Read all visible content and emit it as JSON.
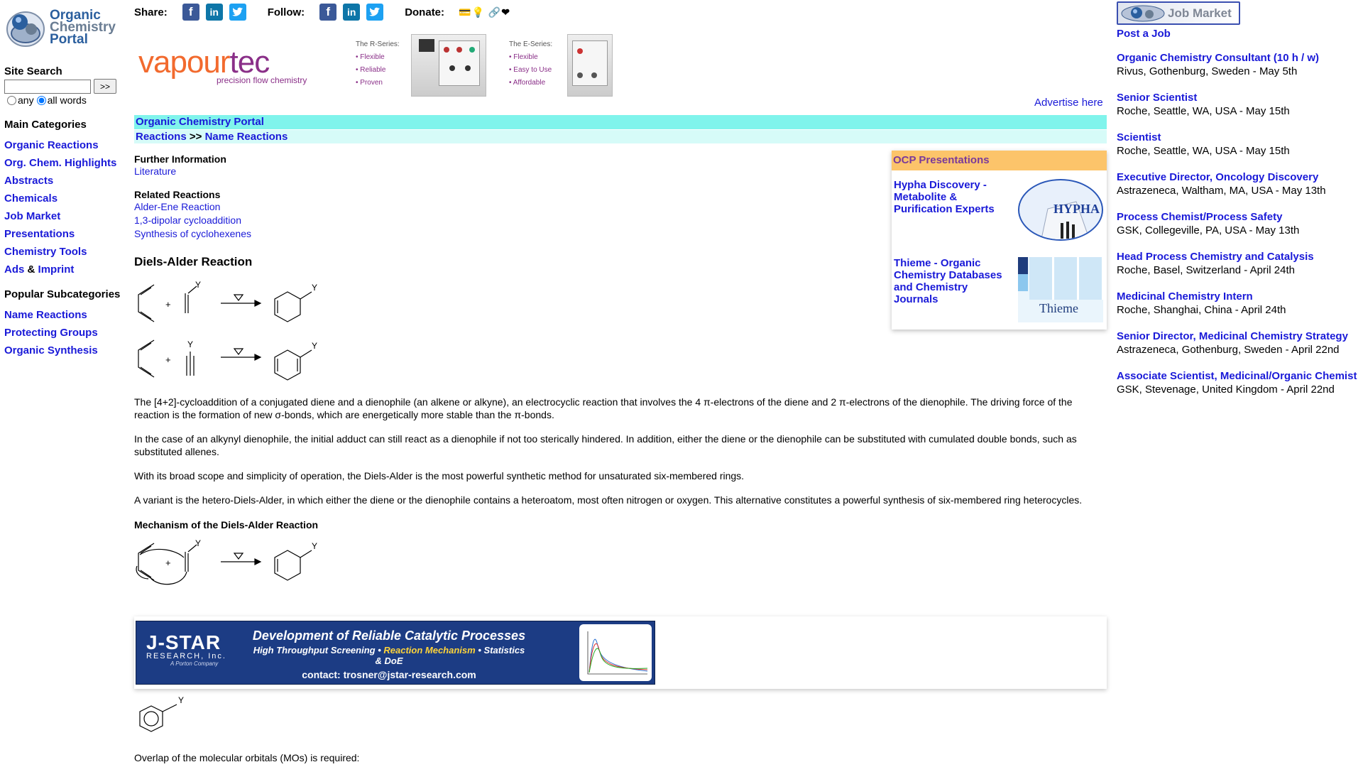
{
  "left": {
    "logo": {
      "line1": "Organic",
      "line2": "Chemistry",
      "line3": "Portal"
    },
    "site_search": {
      "title": "Site Search",
      "button": ">>",
      "value": "",
      "option_any": "any",
      "option_all": "all words",
      "selected": "all words"
    },
    "main_categories": {
      "title": "Main Categories",
      "items": [
        "Organic Reactions",
        "Org. Chem. Highlights",
        "Abstracts",
        "Chemicals",
        "Job Market",
        "Presentations",
        "Chemistry Tools"
      ],
      "ads": "Ads",
      "amp": "&",
      "imprint": "Imprint"
    },
    "popular": {
      "title": "Popular Subcategories",
      "items": [
        "Name Reactions",
        "Protecting Groups",
        "Organic Synthesis"
      ]
    }
  },
  "header": {
    "share_label": "Share:",
    "follow_label": "Follow:",
    "donate_label": "Donate:",
    "icons": [
      "facebook-icon",
      "linkedin-icon",
      "twitter-icon"
    ],
    "donate_icons": "💳💡 🔗❤"
  },
  "ad_banner": {
    "brand_a": "vapour",
    "brand_b": "tec",
    "tagline": "precision flow chemistry",
    "r_series": {
      "title": "The R-Series:",
      "items": [
        "• Flexible",
        "• Reliable",
        "• Proven"
      ]
    },
    "e_series": {
      "title": "The E-Series:",
      "items": [
        "• Flexible",
        "• Easy to Use",
        "• Affordable"
      ]
    },
    "advertise": "Advertise here"
  },
  "breadcrumb": {
    "portal": "Organic Chemistry Portal",
    "reactions": "Reactions",
    "sep": ">>",
    "name_reactions": "Name Reactions"
  },
  "main": {
    "further_title": "Further Information",
    "literature": "Literature",
    "related_title": "Related Reactions",
    "related": [
      "Alder-Ene Reaction",
      "1,3-dipolar cycloaddition",
      "Synthesis of cyclohexenes"
    ],
    "page_title": "Diels-Alder Reaction",
    "scheme_labels": {
      "plus": "+",
      "heat": "△",
      "y": "Y"
    },
    "paragraphs": [
      "The [4+2]-cycloaddition of a conjugated diene and a dienophile (an alkene or alkyne), an electrocyclic reaction that involves the 4 π-electrons of the diene and 2 π-electrons of the dienophile. The driving force of the reaction is the formation of new σ-bonds, which are energetically more stable than the π-bonds.",
      "In the case of an alkynyl dienophile, the initial adduct can still react as a dienophile if not too sterically hindered. In addition, either the diene or the dienophile can be substituted with cumulated double bonds, such as substituted allenes.",
      "With its broad scope and simplicity of operation, the Diels-Alder is the most powerful synthetic method for unsaturated six-membered rings.",
      "A variant is the hetero-Diels-Alder, in which either the diene or the dienophile contains a heteroatom, most often nitrogen or oxygen. This alternative constitutes a powerful synthesis of six-membered ring heterocycles."
    ],
    "mechanism_title": "Mechanism of the Diels-Alder Reaction",
    "mo_text": "Overlap of the molecular orbitals (MOs) is required:"
  },
  "ocp": {
    "header": "OCP Presentations",
    "items": [
      {
        "title": "Hypha Discovery - Metabolite & Purification Experts",
        "badge": "HYPHA"
      },
      {
        "title": "Thieme - Organic Chemistry Databases and Chemistry Journals",
        "badge": "Thieme"
      }
    ]
  },
  "jstar_ad": {
    "logo": "J-STAR",
    "logo_sub": "RESEARCH, Inc.",
    "logo_small": "A Porton Company",
    "line1": "Development of Reliable Catalytic Processes",
    "line2a": "High Throughput Screening • ",
    "line2b": "Reaction Mechanism",
    "line2c": " • Statistics & DoE",
    "line3": "contact:  trosner@jstar-research.com",
    "colors": {
      "bg": "#1c3c84",
      "accent": "#f58a1f",
      "highlight": "#ffd43a"
    }
  },
  "jobs": {
    "logo_label": "Job Market",
    "post_job": "Post a Job",
    "list": [
      {
        "title": "Organic Chemistry Consultant (10 h / w)",
        "detail": "Rivus, Gothenburg, Sweden - May 5th"
      },
      {
        "title": "Senior Scientist",
        "detail": "Roche, Seattle, WA, USA - May 15th"
      },
      {
        "title": "Scientist",
        "detail": "Roche, Seattle, WA, USA - May 15th"
      },
      {
        "title": "Executive Director, Oncology Discovery",
        "detail": "Astrazeneca, Waltham, MA, USA - May 13th"
      },
      {
        "title": "Process Chemist/Process Safety",
        "detail": "GSK, Collegeville, PA, USA - May 13th"
      },
      {
        "title": "Head Process Chemistry and Catalysis",
        "detail": "Roche, Basel, Switzerland - April 24th"
      },
      {
        "title": "Medicinal Chemistry Intern",
        "detail": "Roche, Shanghai, China - April 24th"
      },
      {
        "title": "Senior Director, Medicinal Chemistry Strategy",
        "detail": "Astrazeneca, Gothenburg, Sweden - April 22nd"
      },
      {
        "title": "Associate Scientist, Medicinal/Organic Chemist",
        "detail": "GSK, Stevenage, United Kingdom - April 22nd"
      }
    ]
  },
  "colors": {
    "link": "#1a1ad8",
    "bar1": "#80f4ec",
    "bar2": "#d6fbf8",
    "ocp_header": "#fcc46a",
    "ocp_header_text": "#7a3a9a"
  }
}
